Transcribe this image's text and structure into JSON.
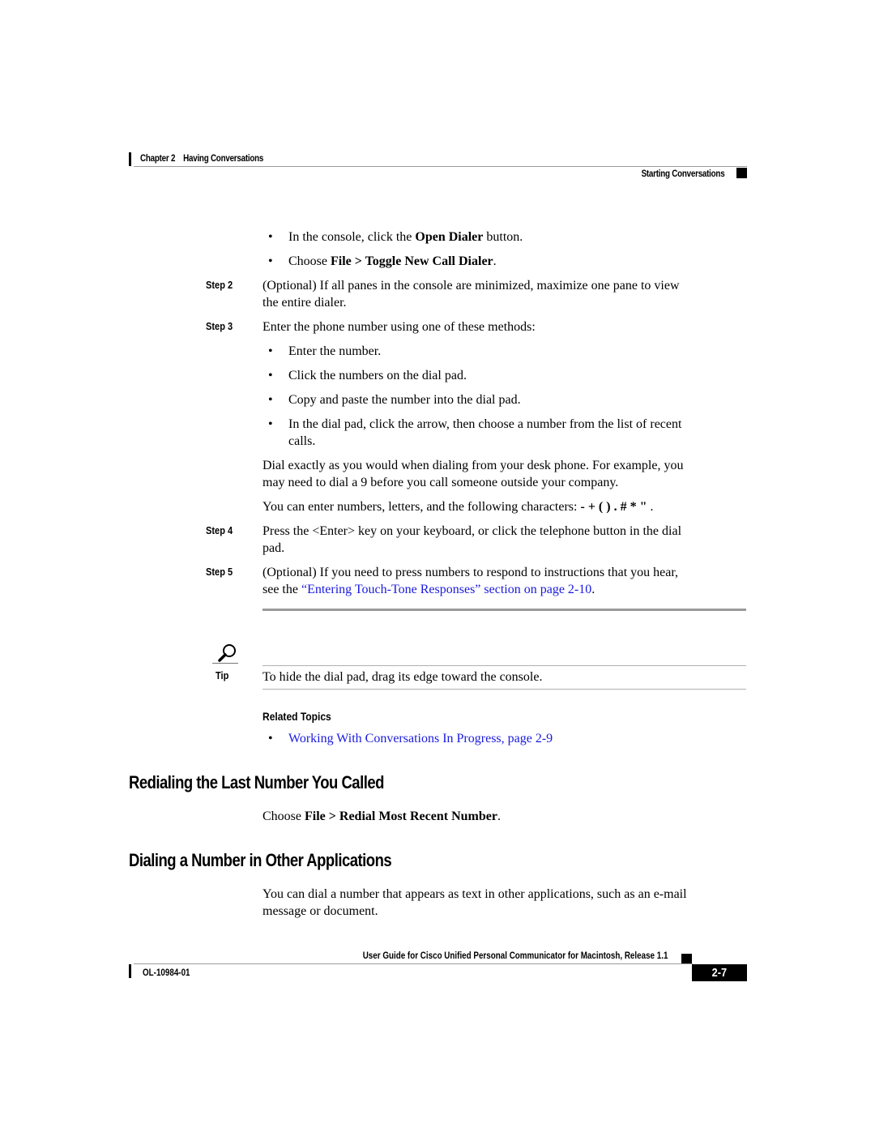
{
  "header": {
    "chapter": "Chapter 2",
    "chapter_title": "Having Conversations",
    "section": "Starting Conversations"
  },
  "intro_bullets": [
    {
      "pre": "In the console, click the ",
      "bold": "Open Dialer",
      "post": " button."
    },
    {
      "pre": "Choose ",
      "bold": "File > Toggle New Call Dialer",
      "post": "."
    }
  ],
  "steps": [
    {
      "label": "Step 2",
      "line1": "(Optional) If all panes in the console are minimized, maximize one pane to view",
      "line2": "the entire dialer."
    },
    {
      "label": "Step 3",
      "line1": "Enter the phone number using one of these methods:"
    },
    {
      "label": "Step 4",
      "line1": "Press the <Enter> key on your keyboard, or click the telephone button in the dial",
      "line2": "pad."
    },
    {
      "label": "Step 5",
      "line1": "(Optional) If you need to press numbers to respond to instructions that you hear,",
      "line2_pre": "see the ",
      "line2_link": "“Entering Touch-Tone Responses” section on page 2-10",
      "line2_post": "."
    }
  ],
  "step3_bullets": [
    {
      "text": "Enter the number."
    },
    {
      "text": "Click the numbers on the dial pad."
    },
    {
      "text": "Copy and paste the number into the dial pad."
    },
    {
      "line1": "In the dial pad, click the arrow, then choose a number from the list of recent",
      "line2": "calls."
    }
  ],
  "step3_notes": {
    "para1_line1": "Dial exactly as you would when dialing from your desk phone. For example, you",
    "para1_line2": "may need to dial a 9 before you call someone outside your company.",
    "para2_pre": "You can enter numbers, letters, and the following characters: ",
    "para2_chars": "- + ( ) . # * \"",
    "para2_post": " ."
  },
  "tip": {
    "icon": "magnifier-icon",
    "label": "Tip",
    "text": "To hide the dial pad, drag its edge toward the console."
  },
  "related_topics": {
    "heading": "Related Topics",
    "links": [
      "Working With Conversations In Progress, page 2-9"
    ]
  },
  "sections": [
    {
      "heading": "Redialing the Last Number You Called",
      "body_pre": "Choose ",
      "body_bold": "File > Redial Most Recent Number",
      "body_post": "."
    },
    {
      "heading": "Dialing a Number in Other Applications",
      "line1": "You can dial a number that appears as text in other applications, such as an e-mail",
      "line2": "message or document."
    }
  ],
  "footer": {
    "guide_title": "User Guide for Cisco Unified Personal Communicator for Macintosh, Release 1.1",
    "doc_number": "OL-10984-01",
    "page_number": "2-7"
  },
  "colors": {
    "link": "#1a1adf",
    "rule": "#9a9a9a"
  }
}
